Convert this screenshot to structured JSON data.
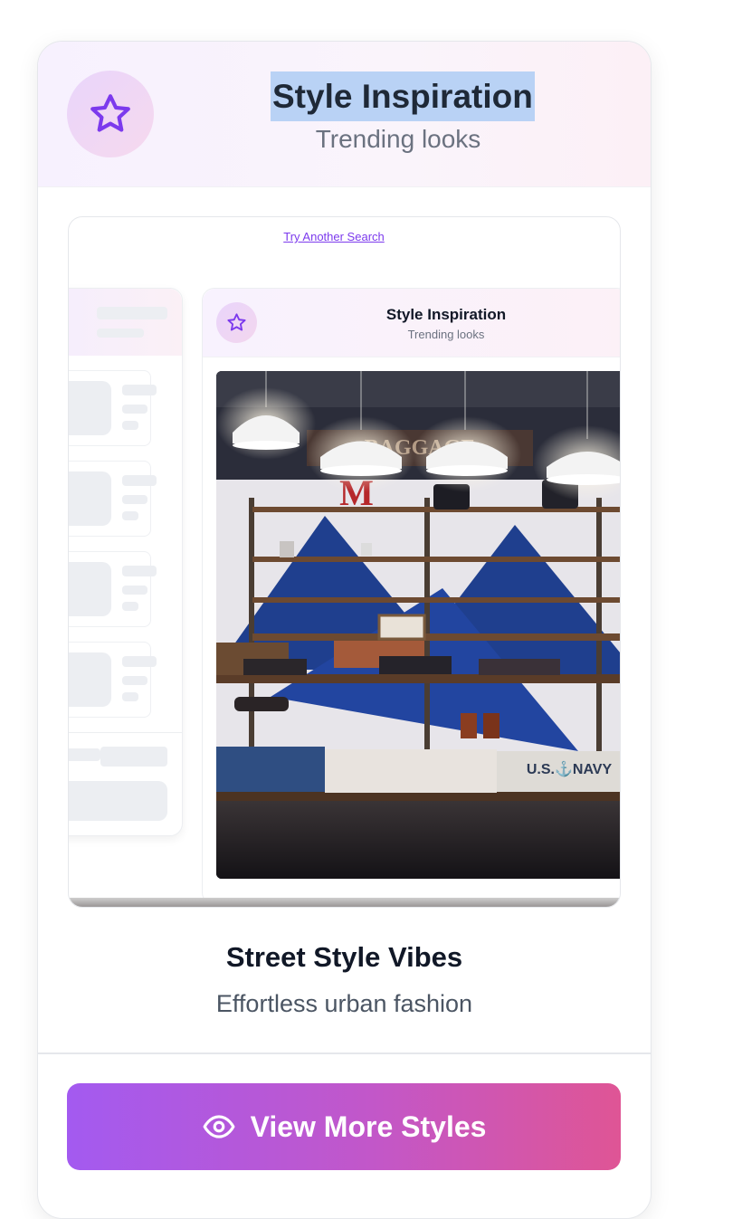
{
  "colors": {
    "accent_purple": "#7c3aed",
    "cta_gradient_start": "#a35af0",
    "cta_gradient_end": "#df5595",
    "selection_highlight": "#b9d2f5"
  },
  "header": {
    "icon": "star-icon",
    "title": "Style Inspiration",
    "subtitle": "Trending looks"
  },
  "preview": {
    "link_text": "Try Another Search",
    "mini_card": {
      "icon": "star-icon",
      "title": "Style Inspiration",
      "subtitle": "Trending looks",
      "photo_text": "U.S.⚓NAVY"
    }
  },
  "card_body": {
    "title": "Street Style Vibes",
    "subtitle": "Effortless urban fashion"
  },
  "cta": {
    "icon": "eye-icon",
    "label": "View More Styles"
  }
}
